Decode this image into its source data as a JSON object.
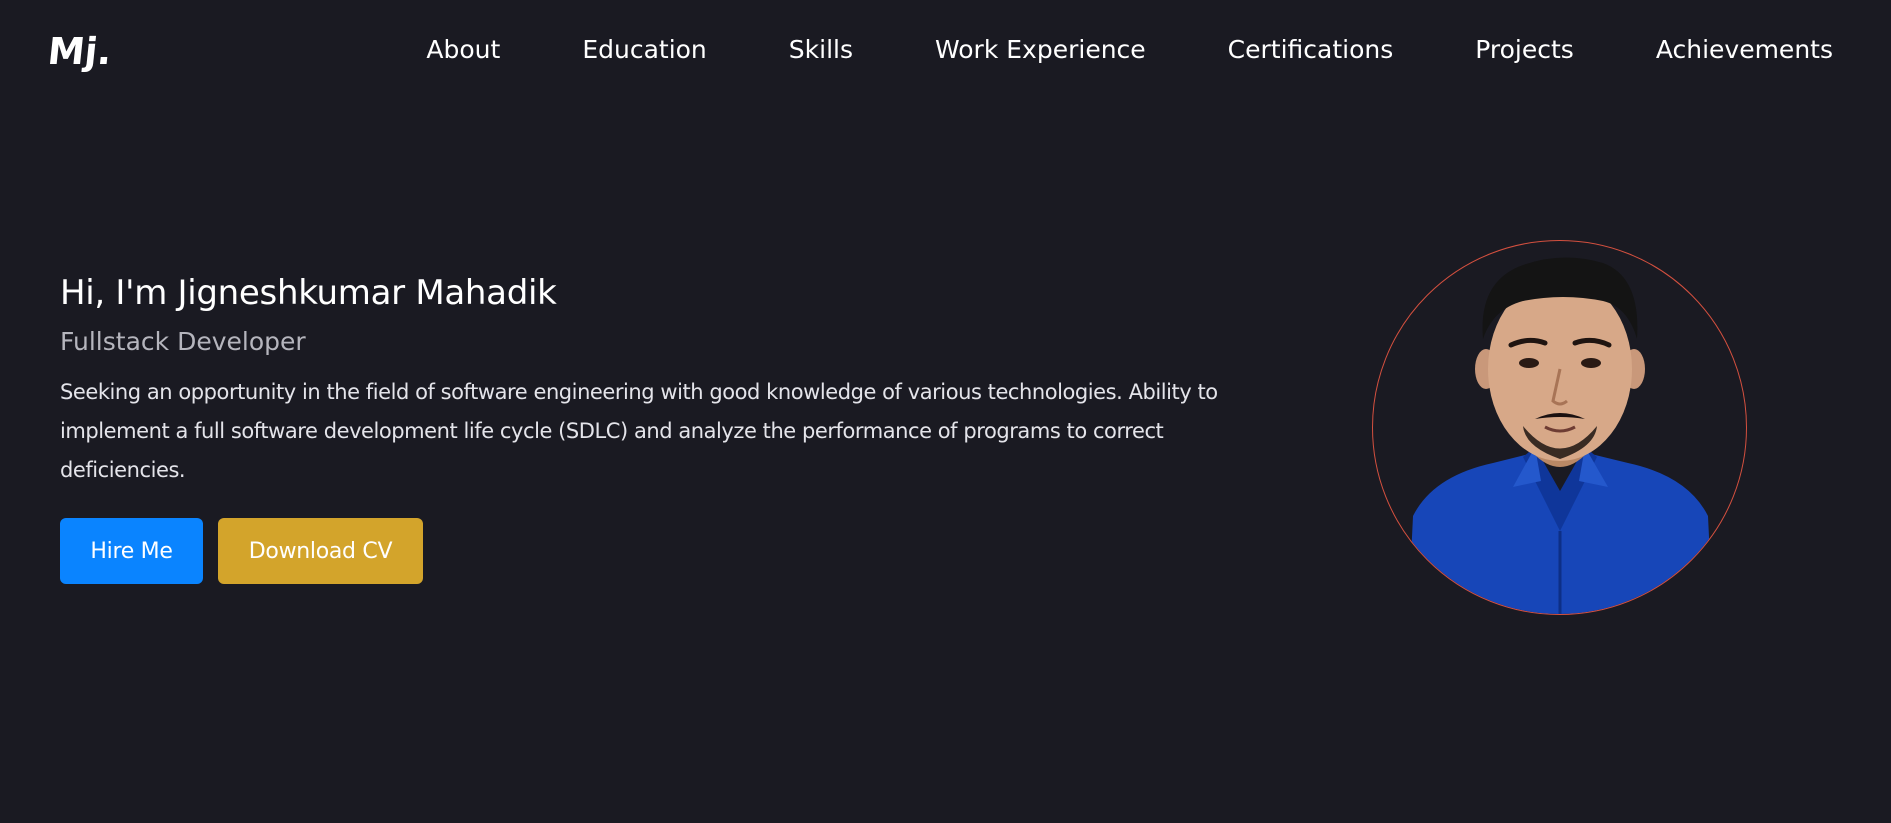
{
  "nav": {
    "logo": "Mj.",
    "items": [
      {
        "label": "About"
      },
      {
        "label": "Education"
      },
      {
        "label": "Skills"
      },
      {
        "label": "Work Experience"
      },
      {
        "label": "Certifications"
      },
      {
        "label": "Projects"
      },
      {
        "label": "Achievements"
      }
    ]
  },
  "hero": {
    "greeting": "Hi, I'm Jigneshkumar Mahadik",
    "role": "Fullstack Developer",
    "summary": "Seeking an opportunity in the field of software engineering with good knowledge of various technologies. Ability to implement a full software development life cycle (SDLC) and analyze the performance of programs to correct deficiencies.",
    "buttons": {
      "hire_label": "Hire Me",
      "cv_label": "Download CV"
    }
  },
  "colors": {
    "background": "#1a1a22",
    "hire_button": "#0a84ff",
    "cv_button": "#d3a42b",
    "avatar_border": "#d4503f"
  }
}
